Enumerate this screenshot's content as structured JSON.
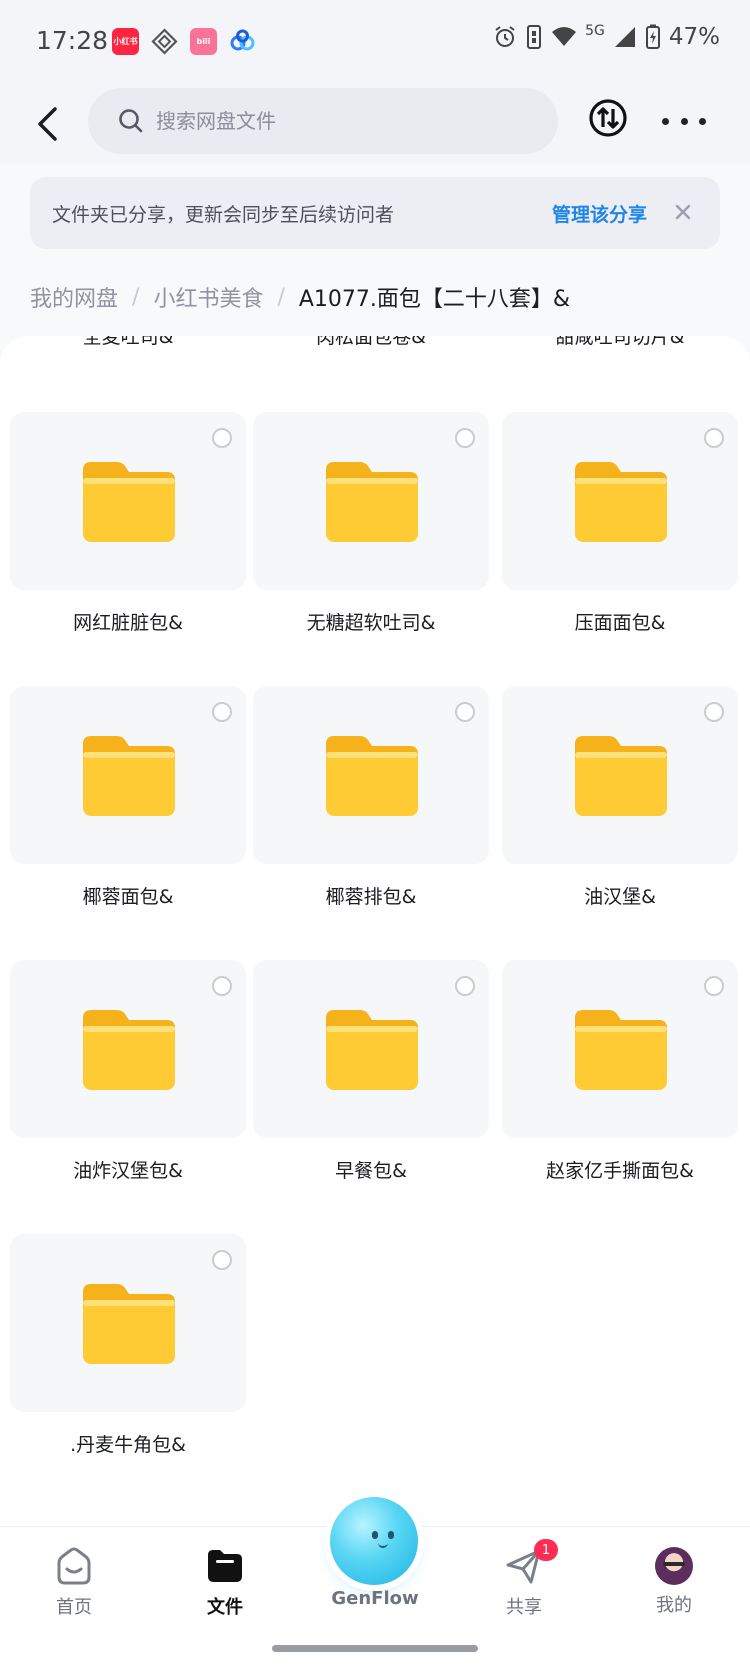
{
  "status_bar": {
    "time": "17:28",
    "network": "5G",
    "battery": "47%",
    "app_icons": [
      "xiaohongshu-app-icon",
      "diamond-app-icon",
      "bilibili-app-icon",
      "baidu-netdisk-app-icon"
    ]
  },
  "top_bar": {
    "search_placeholder": "搜索网盘文件"
  },
  "share_banner": {
    "text": "文件夹已分享，更新会同步至后续访问者",
    "action": "管理该分享"
  },
  "breadcrumb": {
    "items": [
      "我的网盘",
      "小红书美食"
    ],
    "current": "A1077.面包【二十八套】&"
  },
  "partial_row": [
    "全麦吐司&",
    "肉松面包卷&",
    "甜咸吐司切片&"
  ],
  "folders": [
    {
      "name": "网红脏脏包&"
    },
    {
      "name": "无糖超软吐司&"
    },
    {
      "name": "压面面包&"
    },
    {
      "name": "椰蓉面包&"
    },
    {
      "name": "椰蓉排包&"
    },
    {
      "name": "油汉堡&"
    },
    {
      "name": "油炸汉堡包&"
    },
    {
      "name": "早餐包&"
    },
    {
      "name": "赵家亿手撕面包&"
    },
    {
      "name": ".丹麦牛角包&"
    }
  ],
  "bottom_nav": {
    "home": "首页",
    "files": "文件",
    "genflow": "GenFlow",
    "share": "共享",
    "share_badge": "1",
    "me": "我的"
  },
  "colors": {
    "accent_blue": "#1f86e8",
    "folder_yellow": "#ffc933",
    "badge_red": "#ff2d55"
  }
}
